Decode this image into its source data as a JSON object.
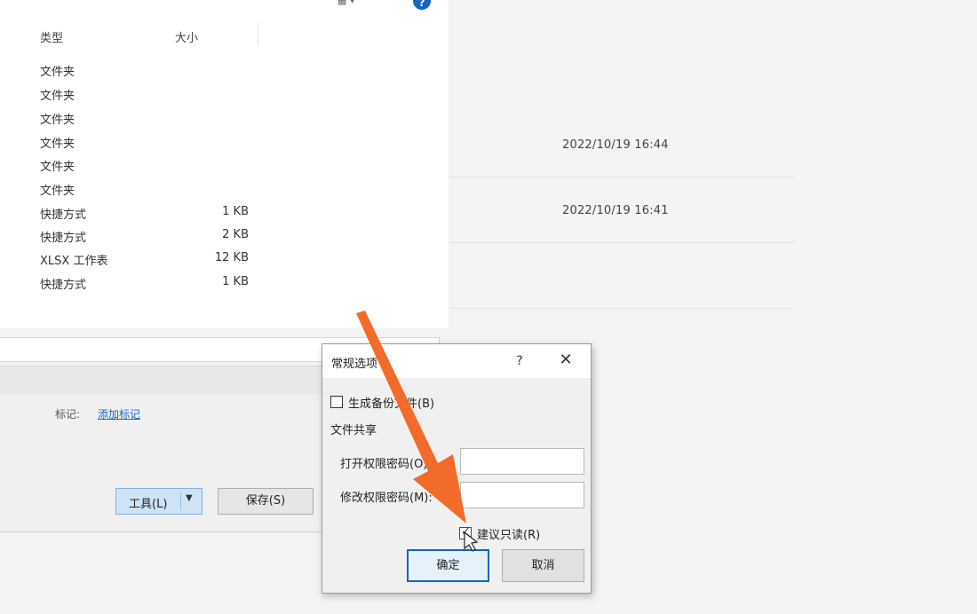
{
  "save_dialog": {
    "columns": {
      "type": "类型",
      "size": "大小"
    },
    "files": [
      {
        "type": "文件夹",
        "size": ""
      },
      {
        "type": "文件夹",
        "size": ""
      },
      {
        "type": "文件夹",
        "size": ""
      },
      {
        "type": "文件夹",
        "size": ""
      },
      {
        "type": "文件夹",
        "size": ""
      },
      {
        "type": "文件夹",
        "size": ""
      },
      {
        "type": "快捷方式",
        "size": "1 KB"
      },
      {
        "type": "快捷方式",
        "size": "2 KB"
      },
      {
        "type": "XLSX 工作表",
        "size": "12 KB"
      },
      {
        "type": "快捷方式",
        "size": "1 KB"
      }
    ],
    "tags_label": "标记:",
    "tags_link": "添加标记",
    "tools_label": "工具(L)",
    "save_label": "保存(S)",
    "help_icon_glyph": "?"
  },
  "background": {
    "rows": [
      {
        "date": "2022/10/19 16:44"
      },
      {
        "date": "2022/10/19 16:41"
      }
    ]
  },
  "options_dialog": {
    "title": "常规选项",
    "help": "?",
    "close": "✕",
    "backup_label": "生成备份文件(B)",
    "backup_checked": false,
    "sharing_label": "文件共享",
    "open_password_label": "打开权限密码(O):",
    "open_password_value": "",
    "modify_password_label": "修改权限密码(M):",
    "modify_password_value": "",
    "readonly_label": "建议只读(R)",
    "readonly_checked": true,
    "ok_label": "确定",
    "cancel_label": "取消"
  },
  "colors": {
    "annotation_arrow": "#f26b2b",
    "accent": "#0a66c2",
    "link": "#1a64c8"
  },
  "icons": {
    "arrow": "orange-pointer-arrow-icon",
    "cursor": "hand-cursor-icon"
  }
}
